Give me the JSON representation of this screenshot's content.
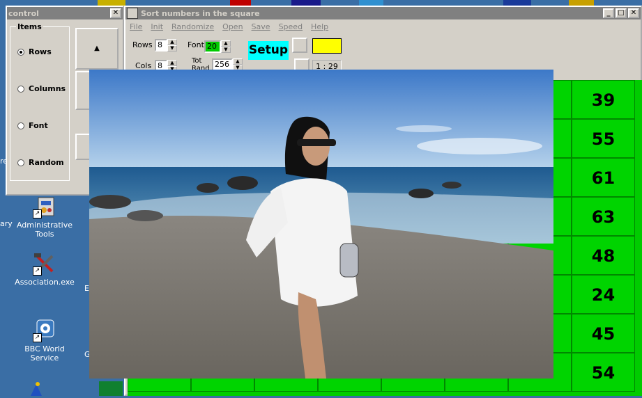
{
  "desktop": {
    "icons": [
      {
        "label": "Administrative\nTools",
        "name": "administrative-tools-icon"
      },
      {
        "label": "Association.exe",
        "name": "association-exe-icon"
      },
      {
        "label": "BBC World Service",
        "name": "bbc-world-service-icon"
      }
    ],
    "fragments": {
      "ary": "ary",
      "re": "re",
      "e": "E",
      "g": "G"
    }
  },
  "control_window": {
    "title": "control",
    "close": "✕",
    "group_title": "Items",
    "options": [
      {
        "label": "Rows",
        "selected": true
      },
      {
        "label": "Columns",
        "selected": false
      },
      {
        "label": "Font",
        "selected": false
      },
      {
        "label": "Random",
        "selected": false
      }
    ],
    "up_arrow": "▲"
  },
  "main_window": {
    "title": "Sort numbers in the square",
    "controls": {
      "minimize": "_",
      "maximize": "□",
      "close": "✕"
    },
    "menu": [
      "File",
      "Init",
      "Randomize",
      "Open",
      "Save",
      "Speed",
      "Help"
    ],
    "rows_label": "Rows",
    "rows_value": "8",
    "cols_label": "Cols",
    "cols_value": "8",
    "font_label": "Font",
    "font_value": "20",
    "tot_label": "Tot\nRand",
    "tot_value": "256",
    "setup_label": "Setup",
    "time": "1 : 29",
    "colors": {
      "setup_bg": "#00ffff",
      "swatch": "#ffff00",
      "font_bg": "#00cc00"
    }
  },
  "grid": {
    "visible_column_values": [
      "39",
      "55",
      "61",
      "63",
      "48",
      "24",
      "45",
      "54"
    ],
    "cell_color": "#00d400"
  }
}
